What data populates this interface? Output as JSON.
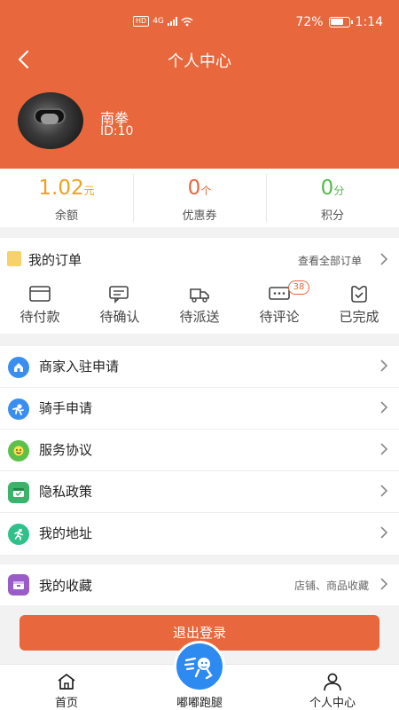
{
  "status_bar": {
    "network": "4G",
    "hd_label": "HD",
    "battery": "72%",
    "time": "1:14"
  },
  "nav": {
    "title": "个人中心"
  },
  "profile": {
    "name": "南拳",
    "id_text": "ID:10"
  },
  "stats": [
    {
      "value": "1.02",
      "unit": "元",
      "label": "余额",
      "color": "#f0a020"
    },
    {
      "value": "0",
      "unit": "个",
      "label": "优惠券",
      "color": "#e8673c"
    },
    {
      "value": "0",
      "unit": "分",
      "label": "积分",
      "color": "#55b84a"
    }
  ],
  "orders": {
    "title": "我的订单",
    "view_all": "查看全部订单",
    "tabs": [
      {
        "label": "待付款",
        "icon": "wallet-icon"
      },
      {
        "label": "待确认",
        "icon": "chat-icon"
      },
      {
        "label": "待派送",
        "icon": "truck-icon"
      },
      {
        "label": "待评论",
        "icon": "comment-icon",
        "badge": "38"
      },
      {
        "label": "已完成",
        "icon": "bag-check-icon"
      }
    ]
  },
  "menu": [
    {
      "label": "商家入驻申请",
      "icon": "store-icon",
      "color": "#3a8ef0"
    },
    {
      "label": "骑手申请",
      "icon": "rider-icon",
      "color": "#3a8ef0"
    },
    {
      "label": "服务协议",
      "icon": "smile-icon",
      "color": "#5cc04a"
    },
    {
      "label": "隐私政策",
      "icon": "privacy-icon",
      "color": "#3bb36a"
    },
    {
      "label": "我的地址",
      "icon": "runner-icon",
      "color": "#30c08a"
    }
  ],
  "collection": {
    "label": "我的收藏",
    "hint": "店铺、商品收藏",
    "color": "#9a5cc6"
  },
  "logout": {
    "label": "退出登录"
  },
  "tabbar": [
    {
      "label": "首页",
      "icon": "home-icon"
    },
    {
      "label": "嘟嘟跑腿",
      "icon": "delivery-fab-icon"
    },
    {
      "label": "个人中心",
      "icon": "person-icon"
    }
  ],
  "colors": {
    "brand": "#e8673c",
    "fab": "#2d8af0"
  }
}
